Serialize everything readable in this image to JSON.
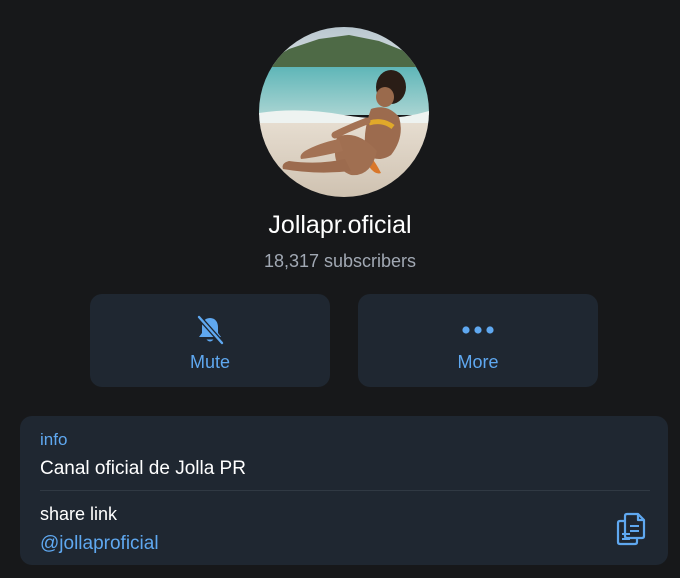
{
  "channel": {
    "name": "Jollapr.oficial",
    "subscribers": "18,317 subscribers"
  },
  "actions": {
    "mute_label": "Mute",
    "more_label": "More"
  },
  "info": {
    "label": "info",
    "description": "Canal oficial de Jolla PR",
    "share_label": "share link",
    "username": "@jollaproficial"
  },
  "icons": {
    "mute": "bell-slash-icon",
    "more": "more-dots-icon",
    "copy": "copy-icon"
  },
  "colors": {
    "background": "#17181a",
    "card": "#1f2731",
    "accent": "#5fa8f0",
    "secondary_text": "#a1a8b3"
  }
}
